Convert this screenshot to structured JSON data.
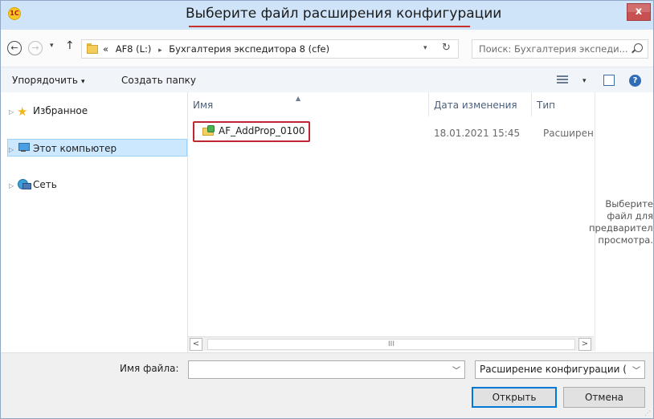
{
  "window": {
    "title": "Выберите файл расширения конфигурации",
    "close_label": "x",
    "app_icon": "1C",
    "accent_color": "#c9302c"
  },
  "navigation": {
    "back_icon": "←",
    "forward_icon": "→",
    "dropdown_icon": "▾",
    "up_icon": "↑",
    "address": {
      "overflow": "«",
      "drive": "AF8 (L:)",
      "separator": "▸",
      "folder": "Бухгалтерия экспедитора 8 (cfe)"
    },
    "refresh_icon": "↻",
    "search_placeholder": "Поиск: Бухгалтерия экспеди..."
  },
  "toolbar": {
    "organize_label": "Упорядочить",
    "new_folder_label": "Создать папку",
    "help_label": "?"
  },
  "sidebar": {
    "items": [
      {
        "label": "Избранное",
        "icon": "star-icon"
      },
      {
        "label": "Этот компьютер",
        "icon": "computer-icon",
        "selected": true
      },
      {
        "label": "Сеть",
        "icon": "network-icon"
      }
    ]
  },
  "file_list": {
    "columns": [
      "Имя",
      "Дата изменения",
      "Тип"
    ],
    "rows": [
      {
        "name": "AF_AddProp_0100",
        "date": "18.01.2021 15:45",
        "type": "Расширение"
      }
    ],
    "scroll_thumb": "III"
  },
  "preview": {
    "text": "Выберите\nфайл для\nпредварительного\nпросмотра."
  },
  "footer": {
    "filename_label": "Имя файла:",
    "filename_value": "",
    "filter_value": "Расширение конфигурации (*.cfe)",
    "open_label": "Открыть",
    "cancel_label": "Отмена"
  }
}
